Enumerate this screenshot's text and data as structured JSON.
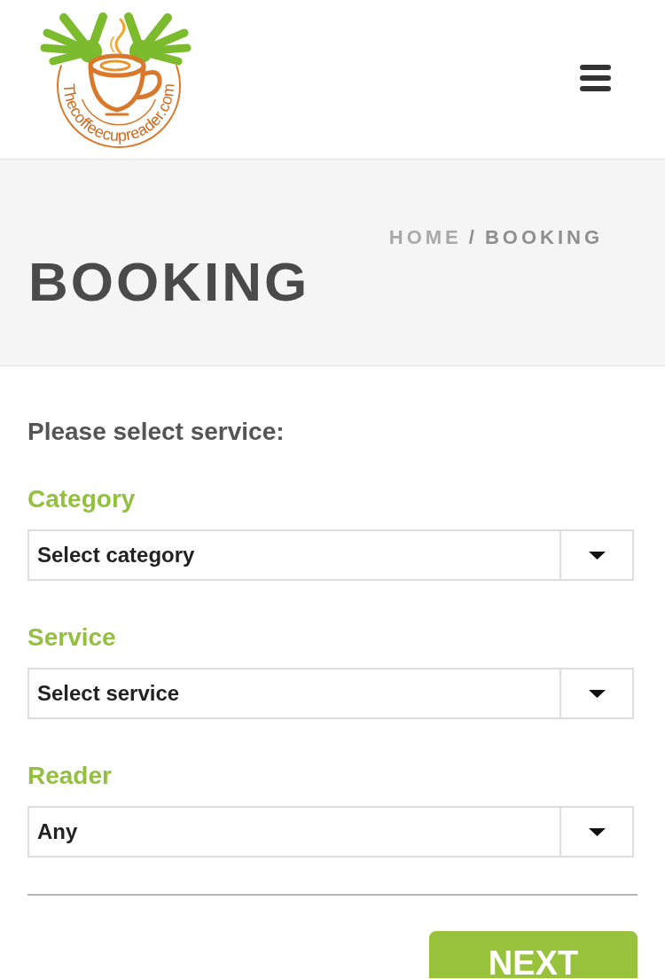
{
  "header": {
    "logo_text": "Thecoffeecupreader.com"
  },
  "banner": {
    "breadcrumb": [
      {
        "label": "HOME",
        "kind": "link"
      },
      {
        "label": "/",
        "kind": "separator"
      },
      {
        "label": "BOOKING",
        "kind": "current"
      }
    ],
    "title": "BOOKING"
  },
  "form": {
    "heading": "Please select service:",
    "fields": [
      {
        "label": "Category",
        "value": "Select category"
      },
      {
        "label": "Service",
        "value": "Select service"
      },
      {
        "label": "Reader",
        "value": "Any"
      }
    ],
    "button": "NEXT"
  }
}
